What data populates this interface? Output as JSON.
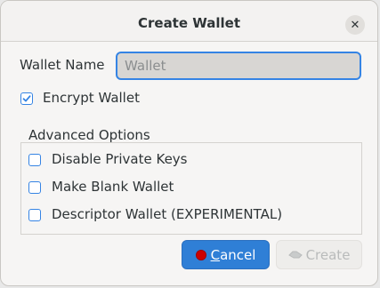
{
  "dialog": {
    "title": "Create Wallet",
    "close_icon": "close-icon"
  },
  "wallet_name": {
    "label": "Wallet Name",
    "value": "",
    "placeholder": "Wallet"
  },
  "encrypt": {
    "label": "Encrypt Wallet",
    "checked": true
  },
  "advanced": {
    "title": "Advanced Options",
    "options": [
      {
        "label": "Disable Private Keys",
        "checked": false
      },
      {
        "label": "Make Blank Wallet",
        "checked": false
      },
      {
        "label": "Descriptor Wallet (EXPERIMENTAL)",
        "checked": false
      }
    ]
  },
  "buttons": {
    "cancel_label": "Cancel",
    "create_label": "Create"
  },
  "colors": {
    "accent": "#3584e4",
    "cancel_bg": "#2f7fd6",
    "cancel_icon": "#cc0000"
  }
}
